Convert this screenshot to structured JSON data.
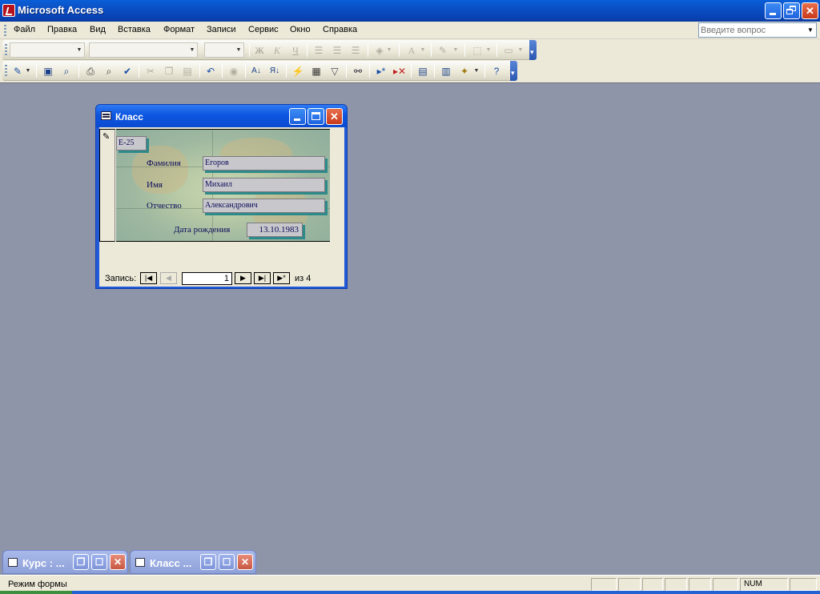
{
  "app": {
    "title": "Microsoft Access"
  },
  "menu": {
    "items": [
      "Файл",
      "Правка",
      "Вид",
      "Вставка",
      "Формат",
      "Записи",
      "Сервис",
      "Окно",
      "Справка"
    ],
    "help_placeholder": "Введите вопрос"
  },
  "toolbar_format": {
    "buttons": [
      {
        "name": "bold-button",
        "glyph": "Ж"
      },
      {
        "name": "italic-button",
        "glyph": "К"
      },
      {
        "name": "underline-button",
        "glyph": "Ч"
      },
      {
        "name": "font-color-button",
        "glyph": "A"
      }
    ]
  },
  "form": {
    "title": "Класс",
    "group_value": "Е-25",
    "fields": [
      {
        "label": "Фамилия",
        "value": "Егоров"
      },
      {
        "label": "Имя",
        "value": "Михаил"
      },
      {
        "label": "Отчество",
        "value": "Александрович"
      }
    ],
    "birth_label": "Дата рождения",
    "birth_value": "13.10.1983",
    "nav": {
      "label": "Запись:",
      "current": "1",
      "of_text": "из  4"
    }
  },
  "minimized": [
    {
      "title": "Курс : ..."
    },
    {
      "title": "Класс ..."
    }
  ],
  "status": {
    "mode": "Режим формы",
    "num": "NUM"
  },
  "colors": {
    "titlebar": "#0b4fc4",
    "workspace": "#8f95a8",
    "field_shadow": "#2e8a8a",
    "close_button": "#c8391a"
  }
}
